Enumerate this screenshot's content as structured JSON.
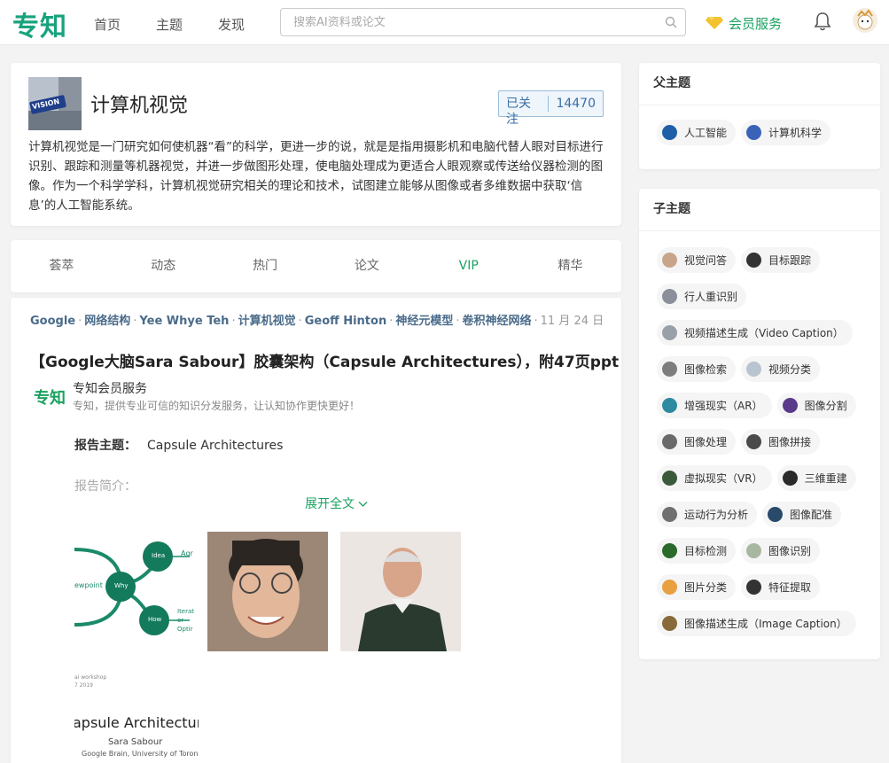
{
  "header": {
    "logo": "专知",
    "nav": [
      "首页",
      "主题",
      "发现"
    ],
    "search_placeholder": "搜索AI资料或论文",
    "vip_label": "会员服务"
  },
  "topic": {
    "title": "计算机视觉",
    "image_text": "VISION",
    "follow_label": "已关注",
    "follow_count": "14470",
    "description": "计算机视觉是一门研究如何使机器“看”的科学，更进一步的说，就是是指用摄影机和电脑代替人眼对目标进行识别、跟踪和测量等机器视觉，并进一步做图形处理，使电脑处理成为更适合人眼观察或传送给仪器检测的图像。作为一个科学学科，计算机视觉研究相关的理论和技术，试图建立能够从图像或者多维数据中获取‘信息’的人工智能系统。"
  },
  "tabs": [
    {
      "label": "荟萃",
      "active": false
    },
    {
      "label": "动态",
      "active": false
    },
    {
      "label": "热门",
      "active": false
    },
    {
      "label": "论文",
      "active": false
    },
    {
      "label": "VIP",
      "active": true
    },
    {
      "label": "精华",
      "active": false
    }
  ],
  "article": {
    "tags": [
      "Google",
      "网络结构",
      "Yee Whye Teh",
      "计算机视觉",
      "Geoff Hinton",
      "神经元模型",
      "卷积神经网络"
    ],
    "date": "11 月 24 日",
    "title": "【Google大脑Sara Sabour】胶囊架构（Capsule Architectures），附47页ppt",
    "source_logo": "专知",
    "source_name": "专知会员服务",
    "source_desc": "专知，提供专业可信的知识分发服务，让认知协作更快更好！",
    "report_theme_label": "报告主题：",
    "report_theme_value": "Capsule Architectures",
    "report_intro_label": "报告简介：",
    "expand_label": "展开全文",
    "diagram_labels": {
      "idea": "Idea",
      "why": "Why",
      "how": "How",
      "agr": "Agr",
      "viewpoint": "ewpoint",
      "iter": "Iterat",
      "or": "or",
      "opti": "Optir"
    },
    "cover": {
      "small_lines": [
        "ai workshop",
        "7 2019"
      ],
      "title": "apsule Architectur",
      "author": "Sara Sabour",
      "affiliation": "Google Brain, University of Toronto"
    }
  },
  "parent_topics": {
    "heading": "父主题",
    "items": [
      {
        "label": "人工智能",
        "color": "#1f5fa8"
      },
      {
        "label": "计算机科学",
        "color": "#3a63b8"
      }
    ]
  },
  "child_topics": {
    "heading": "子主题",
    "rows": [
      [
        {
          "label": "视觉问答",
          "color": "#c8a58a"
        },
        {
          "label": "目标跟踪",
          "color": "#333333"
        }
      ],
      [
        {
          "label": "行人重识别",
          "color": "#8a8f9a"
        }
      ],
      [
        {
          "label": "视频描述生成（Video Caption）",
          "color": "#9aa0a8"
        }
      ],
      [
        {
          "label": "图像检索",
          "color": "#7d7d7d"
        },
        {
          "label": "视频分类",
          "color": "#b8c4d0"
        }
      ],
      [
        {
          "label": "增强现实（AR）",
          "color": "#2e8aa0"
        },
        {
          "label": "图像分割",
          "color": "#5a3a8a"
        }
      ],
      [
        {
          "label": "图像处理",
          "color": "#6a6a6a"
        },
        {
          "label": "图像拼接",
          "color": "#4a4a4a"
        }
      ],
      [
        {
          "label": "虚拟现实（VR）",
          "color": "#3a5a3a"
        },
        {
          "label": "三维重建",
          "color": "#2a2a2a"
        }
      ],
      [
        {
          "label": "运动行为分析",
          "color": "#707070"
        },
        {
          "label": "图像配准",
          "color": "#2a4a6a"
        }
      ],
      [
        {
          "label": "目标检测",
          "color": "#2a6a2a"
        },
        {
          "label": "图像识别",
          "color": "#a8b8a0"
        }
      ],
      [
        {
          "label": "图片分类",
          "color": "#e8a040"
        },
        {
          "label": "特征提取",
          "color": "#333333"
        }
      ],
      [
        {
          "label": "图像描述生成（Image Caption）",
          "color": "#8a6a3a"
        }
      ]
    ]
  }
}
